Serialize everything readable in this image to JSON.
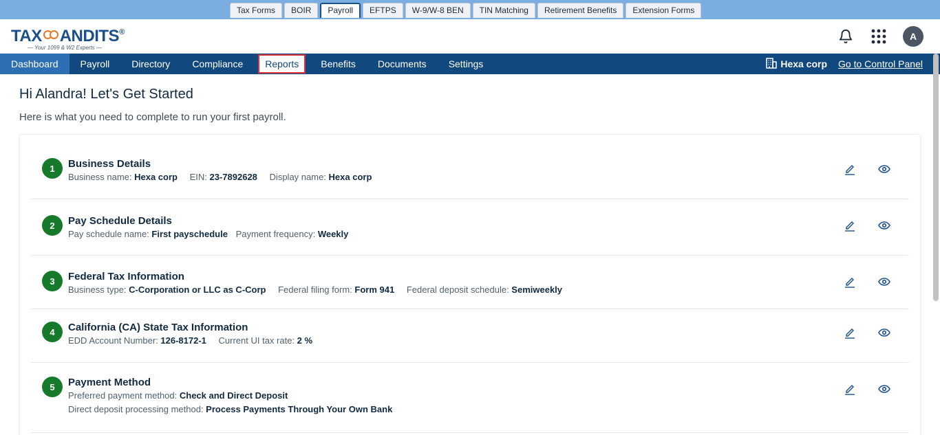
{
  "product_tabs": [
    {
      "label": "Tax Forms"
    },
    {
      "label": "BOIR"
    },
    {
      "label": "Payroll",
      "active": true
    },
    {
      "label": "EFTPS"
    },
    {
      "label": "W-9/W-8 BEN"
    },
    {
      "label": "TIN Matching"
    },
    {
      "label": "Retirement Benefits"
    },
    {
      "label": "Extension Forms"
    }
  ],
  "logo": {
    "brand_left": "TAX",
    "brand_right": "ANDITS",
    "reg": "®",
    "tagline": "Your 1099 & W2 Experts"
  },
  "header": {
    "avatar_initial": "A"
  },
  "nav": {
    "items": [
      {
        "label": "Dashboard"
      },
      {
        "label": "Payroll"
      },
      {
        "label": "Directory"
      },
      {
        "label": "Compliance"
      },
      {
        "label": "Reports"
      },
      {
        "label": "Benefits"
      },
      {
        "label": "Documents"
      },
      {
        "label": "Settings"
      }
    ],
    "company": "Hexa corp",
    "control_panel": "Go to Control Panel"
  },
  "main": {
    "greeting": "Hi Alandra! Let's Get Started",
    "subtitle": "Here is what you need to complete to run your first payroll.",
    "steps": [
      {
        "number": "1",
        "title": "Business Details",
        "lines": [
          [
            {
              "label": "Business name: ",
              "value": "Hexa corp"
            },
            {
              "label": "EIN: ",
              "value": "23-7892628"
            },
            {
              "label": "Display name: ",
              "value": "Hexa corp"
            }
          ]
        ]
      },
      {
        "number": "2",
        "title": "Pay Schedule Details",
        "lines": [
          [
            {
              "label": "Pay schedule name: ",
              "value": "First payschedule"
            },
            {
              "label": "Payment frequency: ",
              "value": "Weekly"
            }
          ]
        ]
      },
      {
        "number": "3",
        "title": "Federal Tax Information",
        "lines": [
          [
            {
              "label": "Business type: ",
              "value": "C-Corporation or LLC as C-Corp"
            },
            {
              "label": "Federal filing form: ",
              "value": "Form 941"
            },
            {
              "label": "Federal deposit schedule: ",
              "value": "Semiweekly"
            }
          ]
        ]
      },
      {
        "number": "4",
        "title": "California (CA) State Tax Information",
        "lines": [
          [
            {
              "label": "EDD Account Number: ",
              "value": "126-8172-1"
            },
            {
              "label": "Current UI tax rate: ",
              "value": "2 %"
            }
          ]
        ]
      },
      {
        "number": "5",
        "title": "Payment Method",
        "lines": [
          [
            {
              "label": "Preferred payment method: ",
              "value": "Check and Direct Deposit"
            }
          ],
          [
            {
              "label": "Direct deposit processing method: ",
              "value": "Process Payments Through Your Own Bank"
            }
          ]
        ]
      }
    ]
  },
  "icons": {
    "bell": "bell-icon",
    "apps": "apps-grid-icon",
    "building": "building-icon",
    "edit": "pencil-icon",
    "view": "eye-icon"
  }
}
